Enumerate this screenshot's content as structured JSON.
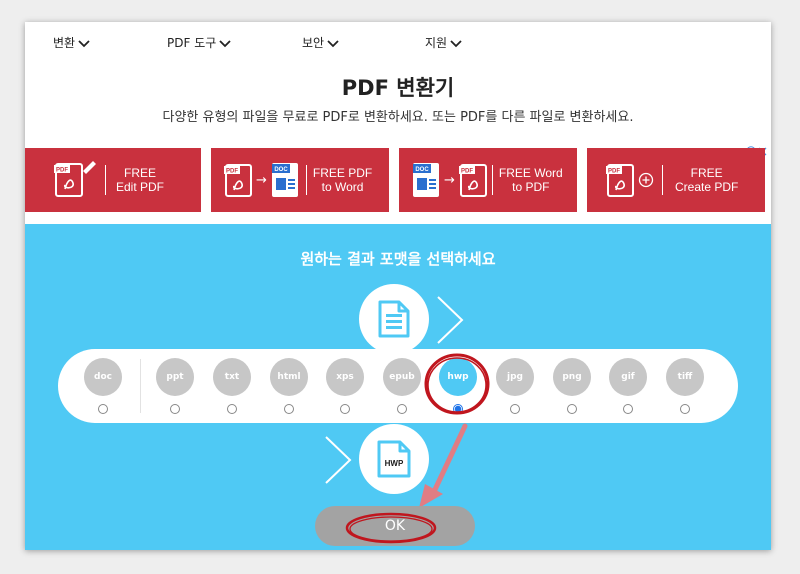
{
  "nav": {
    "items": [
      {
        "label": "변환"
      },
      {
        "label": "PDF 도구"
      },
      {
        "label": "보안"
      },
      {
        "label": "지원"
      }
    ]
  },
  "header": {
    "title": "PDF 변환기",
    "subtitle": "다양한 유형의 파일을 무료로 PDF로 변환하세요. 또는 PDF를 다른 파일로 변환하세요."
  },
  "ads": [
    {
      "line1": "FREE",
      "line2": "Edit PDF",
      "icon_badges": [
        "PDF"
      ]
    },
    {
      "line1": "FREE PDF",
      "line2": "to Word",
      "icon_badges": [
        "PDF",
        "DOC"
      ]
    },
    {
      "line1": "FREE Word",
      "line2": "to PDF",
      "icon_badges": [
        "DOC",
        "PDF"
      ]
    },
    {
      "line1": "FREE",
      "line2": "Create PDF",
      "icon_badges": [
        "PDF"
      ]
    }
  ],
  "ad_info_icons": [
    "info-icon",
    "close-icon"
  ],
  "converter": {
    "heading": "원하는 결과 포맷을 선택하세요",
    "formats": [
      "doc",
      "ppt",
      "txt",
      "html",
      "xps",
      "epub",
      "hwp",
      "jpg",
      "png",
      "gif",
      "tiff"
    ],
    "selected_format": "hwp",
    "result_badge": "HWP",
    "ok_label": "OK"
  },
  "colors": {
    "ad_red": "#c9313e",
    "panel_blue": "#4fc9f4",
    "unselected_gray": "#c7c7c7",
    "annotation_red": "#c0161e",
    "annotation_arrow": "#e07d84"
  }
}
